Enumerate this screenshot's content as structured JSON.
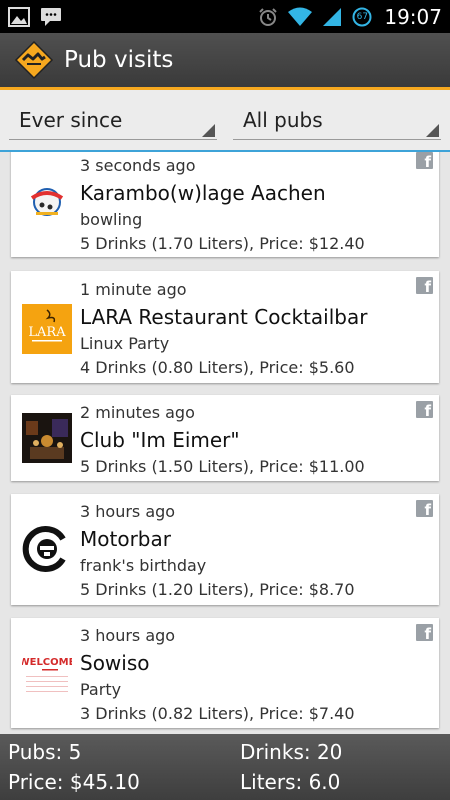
{
  "status_bar": {
    "time": "19:07",
    "battery": "67",
    "icons": [
      "image-notification-icon",
      "chat-notification-icon",
      "alarm-icon",
      "wifi-icon",
      "signal-icon",
      "battery-icon"
    ]
  },
  "action_bar": {
    "title": "Pub visits",
    "icon": "app-logo-icon"
  },
  "filters": {
    "time_range": "Ever since",
    "pub_filter": "All pubs"
  },
  "visits": [
    {
      "time": "3 seconds ago",
      "name": "Karambo(w)lage Aachen",
      "party": "bowling",
      "stats": "5 Drinks (1.70 Liters), Price: $12.40"
    },
    {
      "time": "1 minute ago",
      "name": "LARA Restaurant Cocktailbar",
      "party": "Linux Party",
      "stats": "4 Drinks (0.80 Liters), Price: $5.60",
      "logo_text": "LARA"
    },
    {
      "time": "2 minutes ago",
      "name": "Club \"Im Eimer\"",
      "party": "",
      "stats": "5 Drinks (1.50 Liters), Price: $11.00"
    },
    {
      "time": "3 hours ago",
      "name": "Motorbar",
      "party": "frank's birthday",
      "stats": "5 Drinks (1.20 Liters), Price: $8.70"
    },
    {
      "time": "3 hours ago",
      "name": "Sowiso",
      "party": "Party",
      "stats": "3 Drinks (0.82 Liters), Price: $7.40",
      "logo_text": "WELCOME"
    }
  ],
  "summary": {
    "pubs": "Pubs: 5",
    "drinks": "Drinks: 20",
    "price": "Price: $45.10",
    "liters": "Liters: 6.0"
  },
  "colors": {
    "accent": "#3ea3d8",
    "action_bar_underline": "#f6a81f",
    "facebook_badge": "#9aa0a6"
  }
}
